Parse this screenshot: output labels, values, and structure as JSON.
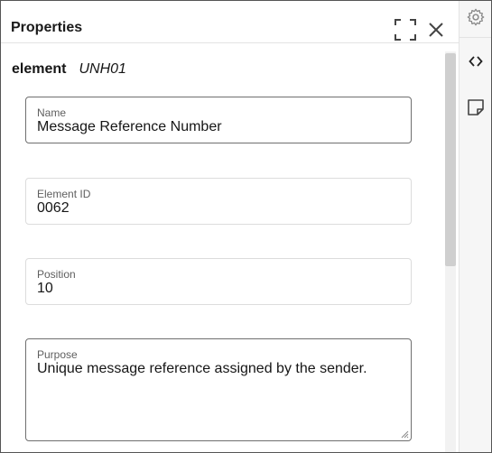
{
  "panel": {
    "title": "Properties",
    "element_label": "element",
    "element_value": "UNH01"
  },
  "fields": {
    "name": {
      "label": "Name",
      "value": "Message Reference Number"
    },
    "element_id": {
      "label": "Element ID",
      "value": "0062"
    },
    "position": {
      "label": "Position",
      "value": "10"
    },
    "purpose": {
      "label": "Purpose",
      "value": "Unique message reference assigned by the sender."
    }
  },
  "icons": {
    "expand": "expand-icon",
    "close": "close-icon",
    "settings": "gear-icon",
    "code": "code-icon",
    "note": "sticky-note-icon"
  }
}
